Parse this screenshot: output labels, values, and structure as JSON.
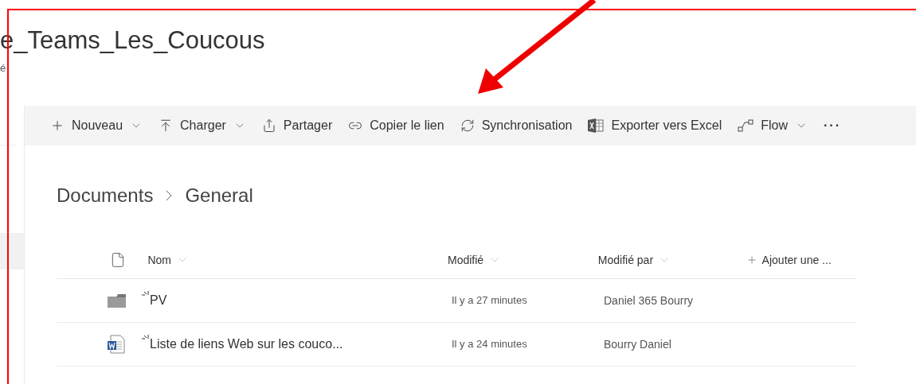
{
  "site": {
    "title": "e_Teams_Les_Coucous",
    "subtitle": "é"
  },
  "toolbar": [
    {
      "kind": "plus",
      "label": "Nouveau",
      "dropdown": true
    },
    {
      "kind": "upload",
      "label": "Charger",
      "dropdown": true
    },
    {
      "kind": "share",
      "label": "Partager",
      "dropdown": false
    },
    {
      "kind": "link",
      "label": "Copier le lien",
      "dropdown": false
    },
    {
      "kind": "sync",
      "label": "Synchronisation",
      "dropdown": false
    },
    {
      "kind": "excel",
      "label": "Exporter vers Excel",
      "dropdown": false
    },
    {
      "kind": "flow",
      "label": "Flow",
      "dropdown": true
    },
    {
      "kind": "more",
      "label": "···",
      "dropdown": false
    }
  ],
  "breadcrumb": [
    "Documents",
    "General"
  ],
  "table": {
    "columns": [
      {
        "label": "Nom",
        "kind": "sort"
      },
      {
        "label": "Modifié",
        "kind": "sort"
      },
      {
        "label": "Modifié par",
        "kind": "sort"
      },
      {
        "label": "Ajouter une ...",
        "kind": "add"
      }
    ],
    "rows": [
      {
        "kind": "folder",
        "name": "PV",
        "modified": "Il y a 27 minutes",
        "modified_by": "Daniel 365 Bourry",
        "new": true
      },
      {
        "kind": "word",
        "name": "Liste de liens Web sur les couco...",
        "modified": "Il y a 24 minutes",
        "modified_by": "Bourry Daniel",
        "new": true
      }
    ]
  }
}
